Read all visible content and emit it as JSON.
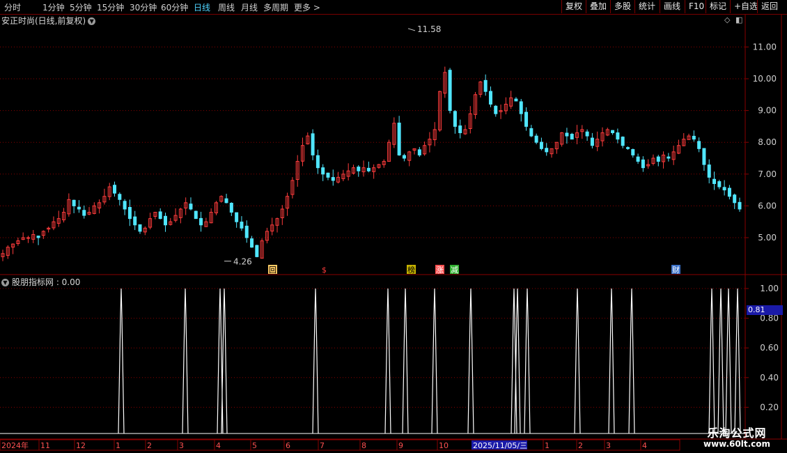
{
  "toolbar": {
    "periods": [
      "分时",
      "1分钟",
      "5分钟",
      "15分钟",
      "30分钟",
      "60分钟",
      "日线",
      "周线",
      "月线",
      "多周期",
      "更多 >"
    ],
    "active_period": "日线",
    "right_buttons": [
      "复权",
      "叠加",
      "多股",
      "统计",
      "画线",
      "F10",
      "标记",
      "+自选",
      "返回"
    ]
  },
  "header": {
    "title": "安正时尚(日线,前复权)"
  },
  "indicator": {
    "title": "股朋指标网 : 0.00",
    "current_value": "0.81"
  },
  "watermark": {
    "line1": "乐淘公式网",
    "line2": "www.60lt.com"
  },
  "colors": {
    "up": "#ff3c3c",
    "down": "#50e6ff",
    "grid": "#8a0000",
    "axis_text": "#d0d0d0"
  },
  "chart_data": [
    {
      "type": "candlestick",
      "title": "安正时尚(日线,前复权)",
      "y_ticks": [
        "11.00",
        "10.00",
        "9.00",
        "8.00",
        "7.00",
        "6.00",
        "5.00"
      ],
      "ylim": [
        4.0,
        12.0
      ],
      "annotations": [
        {
          "label": "11.58",
          "value": 11.58,
          "kind": "high"
        },
        {
          "label": "4.26",
          "value": 4.26,
          "kind": "low"
        }
      ],
      "markers": [
        "回",
        "$",
        "榜",
        "涨",
        "减",
        "财"
      ],
      "close_series": [
        4.5,
        4.7,
        4.8,
        4.9,
        5.0,
        5.0,
        5.1,
        5.0,
        5.2,
        5.3,
        5.5,
        5.6,
        5.8,
        6.2,
        6.0,
        5.9,
        5.7,
        5.8,
        6.0,
        6.1,
        6.3,
        6.6,
        6.4,
        6.2,
        5.9,
        5.6,
        5.4,
        5.2,
        5.3,
        5.6,
        5.8,
        5.6,
        5.4,
        5.5,
        5.7,
        5.9,
        6.1,
        5.9,
        5.6,
        5.4,
        5.5,
        5.8,
        6.1,
        6.3,
        6.1,
        5.8,
        5.5,
        5.3,
        5.0,
        4.7,
        4.4,
        4.9,
        5.2,
        5.4,
        5.6,
        5.9,
        6.3,
        6.8,
        7.4,
        7.9,
        8.2,
        7.6,
        7.2,
        7.0,
        6.9,
        6.8,
        6.9,
        7.0,
        7.1,
        7.2,
        7.1,
        7.2,
        7.1,
        7.2,
        7.3,
        7.4,
        8.0,
        8.6,
        7.6,
        7.5,
        7.7,
        7.8,
        7.6,
        7.9,
        8.1,
        8.4,
        9.6,
        10.2,
        9.0,
        8.5,
        8.3,
        8.4,
        8.9,
        9.5,
        9.9,
        9.6,
        9.2,
        8.9,
        9.0,
        9.2,
        9.4,
        9.3,
        8.9,
        8.5,
        8.2,
        8.0,
        7.8,
        7.7,
        7.8,
        8.0,
        8.3,
        8.2,
        8.1,
        8.3,
        8.4,
        8.2,
        7.9,
        8.1,
        8.3,
        8.4,
        8.3,
        8.1,
        7.9,
        7.8,
        7.6,
        7.4,
        7.2,
        7.3,
        7.5,
        7.4,
        7.6,
        7.5,
        7.7,
        7.9,
        8.1,
        8.2,
        8.1,
        7.8,
        7.3,
        6.9,
        6.7,
        6.6,
        6.5,
        6.3,
        6.1,
        5.9
      ],
      "date_labels": [
        "2024年",
        "11",
        "12",
        "1",
        "2",
        "3",
        "4",
        "5",
        "6",
        "7",
        "8",
        "9",
        "10",
        "2025/11/05/三",
        "1",
        "2",
        "3",
        "4"
      ]
    },
    {
      "type": "line",
      "title": "股朋指标网 : 0.00",
      "y_ticks": [
        "1.00",
        "0.80",
        "0.60",
        "0.40",
        "0.20"
      ],
      "ylim": [
        0,
        1.0
      ],
      "spike_positions": [
        174,
        266,
        316,
        322,
        453,
        557,
        582,
        624,
        676,
        738,
        743,
        757,
        829,
        878,
        907,
        1022,
        1035,
        1046,
        1059
      ],
      "spike_value": 1.0
    }
  ]
}
